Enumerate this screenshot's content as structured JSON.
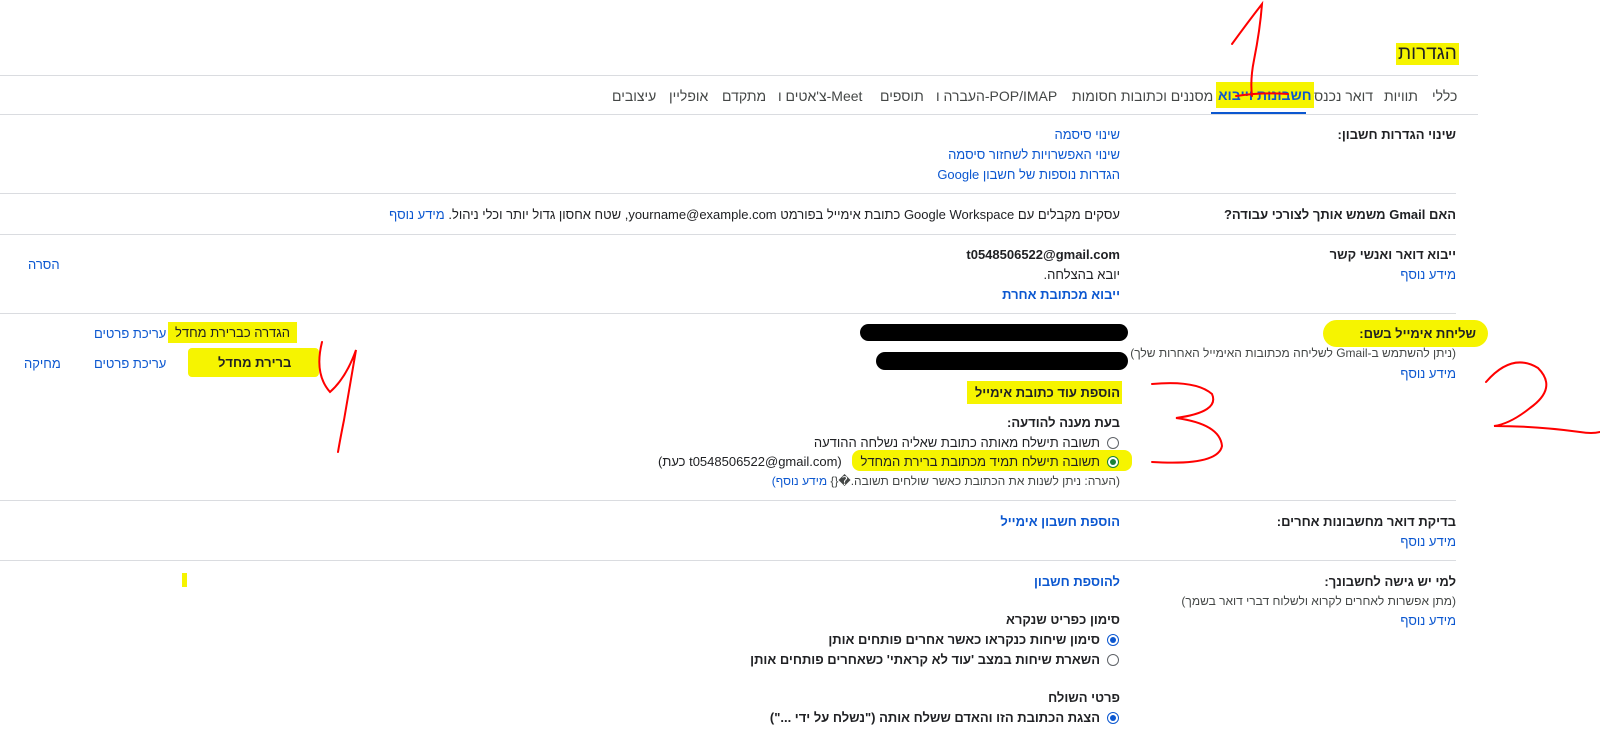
{
  "page": {
    "title": "הגדרות"
  },
  "tabs": [
    {
      "label": "כללי"
    },
    {
      "label": "תוויות"
    },
    {
      "label": "דואר נכנס"
    },
    {
      "label": "חשבונות וייבוא"
    },
    {
      "label": "מסננים וכתובות חסומות"
    },
    {
      "label": "העברה ו-POP/IMAP"
    },
    {
      "label": "תוספים"
    },
    {
      "label": "צ'אטים ו-Meet"
    },
    {
      "label": "מתקדם"
    },
    {
      "label": "אופליין"
    },
    {
      "label": "עיצובים"
    }
  ],
  "change_settings": {
    "label": "שינוי הגדרות חשבון:",
    "links": [
      "שינוי סיסמה",
      "שינוי האפשרויות לשחזור סיסמה",
      "הגדרות נוספות של חשבון Google"
    ]
  },
  "work": {
    "label": "האם Gmail משמש אותך לצורכי עבודה?",
    "text": "עסקים מקבלים עם Google Workspace כתובת אימייל בפורמט yourname@example.com, שטח אחסון גדול יותר וכלי ניהול.",
    "learn": "מידע נוסף"
  },
  "import": {
    "label": "ייבוא דואר ואנשי קשר",
    "learn": "מידע נוסף",
    "email": "t0548506522@gmail.com",
    "status": "יובא בהצלחה.",
    "another": "ייבוא מכתובת אחרת",
    "remove": "הסרה"
  },
  "send_as": {
    "label": "שליחת אימייל בשם:",
    "sub": "(ניתן להשתמש ב-Gmail לשליחה מכתובות האימייל האחרות שלך)",
    "learn": "מידע נוסף",
    "row1_status": "הגדרה כברירת מחדל",
    "row1_edit": "עריכת פרטים",
    "row2_default": "ברירת מחדל",
    "row2_edit": "עריכת פרטים",
    "row2_delete": "מחיקה",
    "add": "הוספת עוד כתובת אימייל",
    "reply_heading": "בעת מענה להודעה:",
    "reply_opt1": "תשובה תישלח מאותה כתובת שאליה נשלחה ההודעה",
    "reply_opt2": "תשובה תישלח תמיד מכתובת ברירת המחדל",
    "reply_opt2_suffix": "(כעת t0548506522@gmail.com)",
    "note": "(הערה: ניתן לשנות את הכתובת כאשר שולחים תשובה.�{}",
    "note_learn": "מידע נוסף)"
  },
  "check_mail": {
    "label": "בדיקת דואר מחשבונות אחרים:",
    "learn": "מידע נוסף",
    "add": "הוספת חשבון אימייל"
  },
  "access": {
    "label": "למי יש גישה לחשבונך:",
    "sub": "(מתן אפשרות לאחרים לקרוא ולשלוח דברי דואר בשמך)",
    "learn": "מידע נוסף",
    "add": "להוספת חשבון",
    "mark_heading": "סימון כפריט שנקרא",
    "mark_opt1": "סימון שיחות כנקראו כאשר אחרים פותחים אותן",
    "mark_opt2": "השארת שיחות במצב 'עוד לא קראתי' כשאחרים פותחים אותן",
    "sender_heading": "פרטי השולח",
    "sender_opt1": "הצגת הכתובת הזו והאדם ששלח אותה (\"נשלח על ידי ...\")"
  },
  "annotations": {
    "n1": "1",
    "n2": "2",
    "n3": "3",
    "n4": "4",
    "ink": "#ff0000",
    "marker": "#f6f400"
  }
}
